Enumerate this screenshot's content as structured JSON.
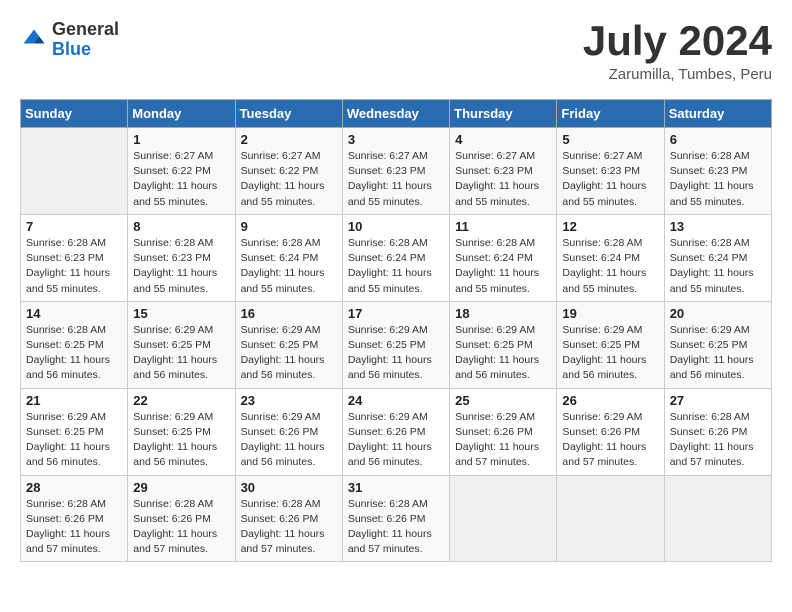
{
  "logo": {
    "general": "General",
    "blue": "Blue"
  },
  "header": {
    "month": "July 2024",
    "location": "Zarumilla, Tumbes, Peru"
  },
  "days_of_week": [
    "Sunday",
    "Monday",
    "Tuesday",
    "Wednesday",
    "Thursday",
    "Friday",
    "Saturday"
  ],
  "weeks": [
    [
      {
        "day": "",
        "info": ""
      },
      {
        "day": "1",
        "info": "Sunrise: 6:27 AM\nSunset: 6:22 PM\nDaylight: 11 hours\nand 55 minutes."
      },
      {
        "day": "2",
        "info": "Sunrise: 6:27 AM\nSunset: 6:22 PM\nDaylight: 11 hours\nand 55 minutes."
      },
      {
        "day": "3",
        "info": "Sunrise: 6:27 AM\nSunset: 6:23 PM\nDaylight: 11 hours\nand 55 minutes."
      },
      {
        "day": "4",
        "info": "Sunrise: 6:27 AM\nSunset: 6:23 PM\nDaylight: 11 hours\nand 55 minutes."
      },
      {
        "day": "5",
        "info": "Sunrise: 6:27 AM\nSunset: 6:23 PM\nDaylight: 11 hours\nand 55 minutes."
      },
      {
        "day": "6",
        "info": "Sunrise: 6:28 AM\nSunset: 6:23 PM\nDaylight: 11 hours\nand 55 minutes."
      }
    ],
    [
      {
        "day": "7",
        "info": "Sunrise: 6:28 AM\nSunset: 6:23 PM\nDaylight: 11 hours\nand 55 minutes."
      },
      {
        "day": "8",
        "info": "Sunrise: 6:28 AM\nSunset: 6:23 PM\nDaylight: 11 hours\nand 55 minutes."
      },
      {
        "day": "9",
        "info": "Sunrise: 6:28 AM\nSunset: 6:24 PM\nDaylight: 11 hours\nand 55 minutes."
      },
      {
        "day": "10",
        "info": "Sunrise: 6:28 AM\nSunset: 6:24 PM\nDaylight: 11 hours\nand 55 minutes."
      },
      {
        "day": "11",
        "info": "Sunrise: 6:28 AM\nSunset: 6:24 PM\nDaylight: 11 hours\nand 55 minutes."
      },
      {
        "day": "12",
        "info": "Sunrise: 6:28 AM\nSunset: 6:24 PM\nDaylight: 11 hours\nand 55 minutes."
      },
      {
        "day": "13",
        "info": "Sunrise: 6:28 AM\nSunset: 6:24 PM\nDaylight: 11 hours\nand 55 minutes."
      }
    ],
    [
      {
        "day": "14",
        "info": "Sunrise: 6:28 AM\nSunset: 6:25 PM\nDaylight: 11 hours\nand 56 minutes."
      },
      {
        "day": "15",
        "info": "Sunrise: 6:29 AM\nSunset: 6:25 PM\nDaylight: 11 hours\nand 56 minutes."
      },
      {
        "day": "16",
        "info": "Sunrise: 6:29 AM\nSunset: 6:25 PM\nDaylight: 11 hours\nand 56 minutes."
      },
      {
        "day": "17",
        "info": "Sunrise: 6:29 AM\nSunset: 6:25 PM\nDaylight: 11 hours\nand 56 minutes."
      },
      {
        "day": "18",
        "info": "Sunrise: 6:29 AM\nSunset: 6:25 PM\nDaylight: 11 hours\nand 56 minutes."
      },
      {
        "day": "19",
        "info": "Sunrise: 6:29 AM\nSunset: 6:25 PM\nDaylight: 11 hours\nand 56 minutes."
      },
      {
        "day": "20",
        "info": "Sunrise: 6:29 AM\nSunset: 6:25 PM\nDaylight: 11 hours\nand 56 minutes."
      }
    ],
    [
      {
        "day": "21",
        "info": "Sunrise: 6:29 AM\nSunset: 6:25 PM\nDaylight: 11 hours\nand 56 minutes."
      },
      {
        "day": "22",
        "info": "Sunrise: 6:29 AM\nSunset: 6:25 PM\nDaylight: 11 hours\nand 56 minutes."
      },
      {
        "day": "23",
        "info": "Sunrise: 6:29 AM\nSunset: 6:26 PM\nDaylight: 11 hours\nand 56 minutes."
      },
      {
        "day": "24",
        "info": "Sunrise: 6:29 AM\nSunset: 6:26 PM\nDaylight: 11 hours\nand 56 minutes."
      },
      {
        "day": "25",
        "info": "Sunrise: 6:29 AM\nSunset: 6:26 PM\nDaylight: 11 hours\nand 57 minutes."
      },
      {
        "day": "26",
        "info": "Sunrise: 6:29 AM\nSunset: 6:26 PM\nDaylight: 11 hours\nand 57 minutes."
      },
      {
        "day": "27",
        "info": "Sunrise: 6:28 AM\nSunset: 6:26 PM\nDaylight: 11 hours\nand 57 minutes."
      }
    ],
    [
      {
        "day": "28",
        "info": "Sunrise: 6:28 AM\nSunset: 6:26 PM\nDaylight: 11 hours\nand 57 minutes."
      },
      {
        "day": "29",
        "info": "Sunrise: 6:28 AM\nSunset: 6:26 PM\nDaylight: 11 hours\nand 57 minutes."
      },
      {
        "day": "30",
        "info": "Sunrise: 6:28 AM\nSunset: 6:26 PM\nDaylight: 11 hours\nand 57 minutes."
      },
      {
        "day": "31",
        "info": "Sunrise: 6:28 AM\nSunset: 6:26 PM\nDaylight: 11 hours\nand 57 minutes."
      },
      {
        "day": "",
        "info": ""
      },
      {
        "day": "",
        "info": ""
      },
      {
        "day": "",
        "info": ""
      }
    ]
  ]
}
